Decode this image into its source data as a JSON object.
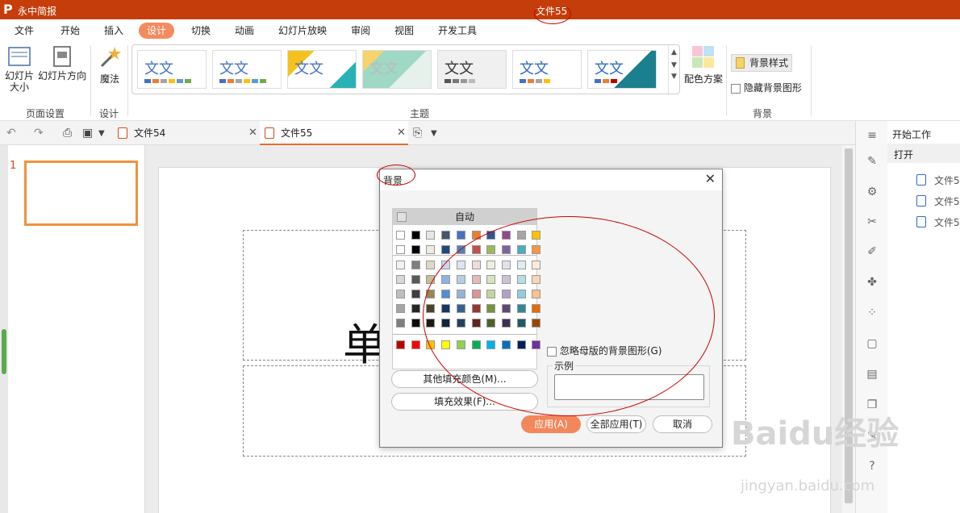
{
  "app": {
    "name": "永中简报",
    "doc_title": "文件55"
  },
  "menu": [
    "文件",
    "开始",
    "插入",
    "设计",
    "切换",
    "动画",
    "幻灯片放映",
    "审阅",
    "视图",
    "开发工具"
  ],
  "ribbon": {
    "slide_size": "幻灯片\n大小",
    "slide_direction": "幻灯片方向",
    "magic": "魔法",
    "group_page_setup": "页面设置",
    "group_design": "设计",
    "group_theme": "主题",
    "color_scheme": "配色方案",
    "bg_style": "背景样式",
    "hide_bg": "隐藏背景图形",
    "group_background": "背景",
    "theme_text": "文文"
  },
  "tabs": [
    {
      "label": "文件54"
    },
    {
      "label": "文件55"
    }
  ],
  "slides": {
    "current": "1",
    "title_text": "单击"
  },
  "right_panel": {
    "title": "开始工作",
    "open": "打开",
    "files": [
      "文件5",
      "文件5",
      "文件5"
    ]
  },
  "dialog": {
    "title": "背景",
    "auto": "自动",
    "ignore_master": "忽略母版的背景图形(G)",
    "example": "示例",
    "more_colors": "其他填充颜色(M)...",
    "fill_effects": "填充效果(F)...",
    "apply": "应用(A)",
    "apply_all": "全部应用(T)",
    "cancel": "取消"
  },
  "watermark": {
    "main": "Baidu经验",
    "sub": "jingyan.baidu.com"
  }
}
